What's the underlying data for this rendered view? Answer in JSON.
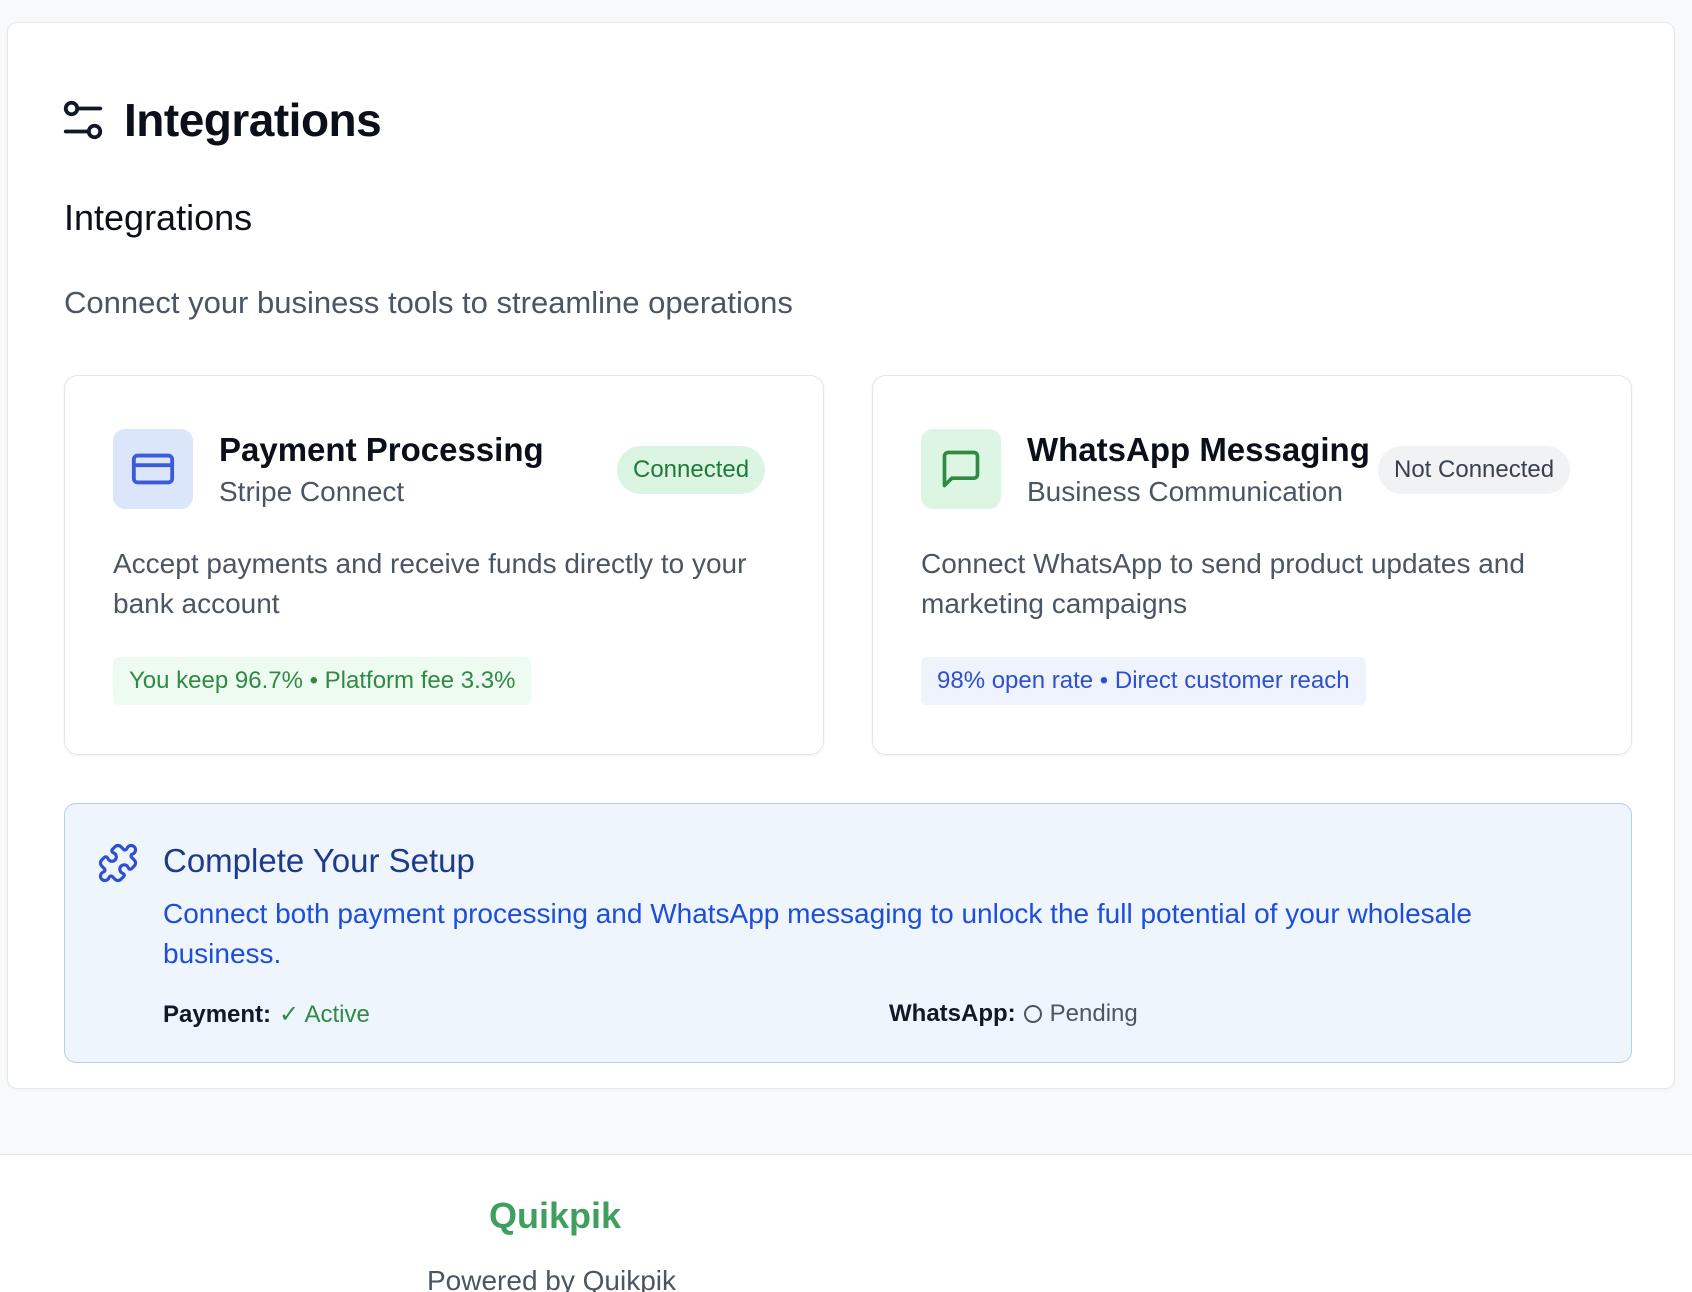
{
  "header": {
    "title": "Integrations",
    "icon": "settings-sliders-icon"
  },
  "section": {
    "title": "Integrations",
    "description": "Connect your business tools to streamline operations"
  },
  "cards": [
    {
      "title": "Payment Processing",
      "subtitle": "Stripe Connect",
      "status": "Connected",
      "description": "Accept payments and receive funds directly to your bank account",
      "metric": "You keep 96.7% • Platform fee 3.3%",
      "icon": "credit-card-icon",
      "accent": "#3b5bdb"
    },
    {
      "title": "WhatsApp Messaging",
      "subtitle": "Business Communication",
      "status": "Not Connected",
      "description": "Connect WhatsApp to send product updates and marketing campaigns",
      "metric": "98% open rate • Direct customer reach",
      "icon": "message-square-icon",
      "accent": "#2f8a44"
    }
  ],
  "setup": {
    "title": "Complete Your Setup",
    "description": "Connect both payment processing and WhatsApp messaging to unlock the full potential of your wholesale business.",
    "icon": "puzzle-icon",
    "payment_label": "Payment:",
    "payment_status": "✓ Active",
    "whatsapp_label": "WhatsApp:",
    "whatsapp_status": "Pending"
  },
  "footer": {
    "brand": "Quikpik",
    "powered": "Powered by Quikpik"
  },
  "colors": {
    "brand_green": "#3f9f5e",
    "connected_bg": "#dcf5e2",
    "setup_bg": "#eff5fd",
    "setup_border": "#b6cff1"
  }
}
